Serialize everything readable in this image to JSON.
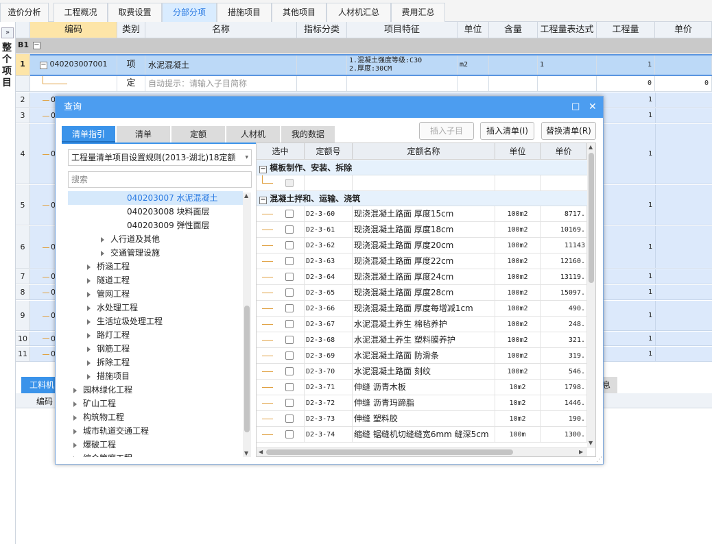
{
  "top_tabs": [
    "造价分析",
    "工程概况",
    "取费设置",
    "分部分项",
    "措施项目",
    "其他项目",
    "人材机汇总",
    "费用汇总"
  ],
  "left_strip": {
    "expand_glyph": "»",
    "label": "整个项目"
  },
  "grid": {
    "headers": [
      "编码",
      "类别",
      "名称",
      "指标分类",
      "项目特征",
      "单位",
      "含量",
      "工程量表达式",
      "工程量",
      "单价"
    ],
    "b1_label": "B1",
    "toggle_minus": "−",
    "row1": {
      "num": "1",
      "code": "040203007001",
      "type": "项",
      "name": "水泥混凝土",
      "feature_line1": "1.混凝土强度等级:C30",
      "feature_line2": "2.厚度:30CM",
      "unit": "m2",
      "expr": "1",
      "qty": "1"
    },
    "row1b": {
      "type": "定",
      "hint": "自动提示：请输入子目简称",
      "qty": "0",
      "price": "0"
    },
    "rows": [
      {
        "num": "2",
        "code_prefix": "0",
        "qty": "1"
      },
      {
        "num": "3",
        "code_prefix": "0",
        "qty": "1"
      },
      {
        "num": "4",
        "code_prefix": "0",
        "qty": "1"
      },
      {
        "num": "5",
        "code_prefix": "0",
        "qty": "1"
      },
      {
        "num": "6",
        "code_prefix": "0",
        "qty": "1"
      },
      {
        "num": "7",
        "code_prefix": "0",
        "qty": "1"
      },
      {
        "num": "8",
        "code_prefix": "0",
        "qty": "1"
      },
      {
        "num": "9",
        "code_prefix": "0",
        "qty": "1"
      },
      {
        "num": "10",
        "code_prefix": "0",
        "qty": "1"
      },
      {
        "num": "11",
        "code_prefix": "0",
        "qty": "1"
      }
    ]
  },
  "bottom": {
    "tab_label": "工料机",
    "header": "编码",
    "right_tab_fragment": "息"
  },
  "dialog": {
    "title": "查询",
    "maximize_glyph": "□",
    "close_glyph": "✕",
    "tabs": [
      "清单指引",
      "清单",
      "定额",
      "人材机",
      "我的数据"
    ],
    "buttons": {
      "insert_sub": "插入子目",
      "insert_list": "插入清单(I)",
      "replace_list": "替换清单(R)"
    },
    "select_value": "工程量清单项目设置规则(2013-湖北)18定额",
    "search_placeholder": "搜索",
    "tree": [
      {
        "text": "040203007  水泥混凝土",
        "level": 3,
        "selected": true
      },
      {
        "text": "040203008  块料面层",
        "level": 3
      },
      {
        "text": "040203009  弹性面层",
        "level": 3
      },
      {
        "text": "人行道及其他",
        "level": 2,
        "arrow": true
      },
      {
        "text": "交通管理设施",
        "level": 2,
        "arrow": true
      },
      {
        "text": "桥涵工程",
        "level": 1,
        "arrow": true
      },
      {
        "text": "隧道工程",
        "level": 1,
        "arrow": true
      },
      {
        "text": "管网工程",
        "level": 1,
        "arrow": true
      },
      {
        "text": "水处理工程",
        "level": 1,
        "arrow": true
      },
      {
        "text": "生活垃圾处理工程",
        "level": 1,
        "arrow": true
      },
      {
        "text": "路灯工程",
        "level": 1,
        "arrow": true
      },
      {
        "text": "钢筋工程",
        "level": 1,
        "arrow": true
      },
      {
        "text": "拆除工程",
        "level": 1,
        "arrow": true
      },
      {
        "text": "措施项目",
        "level": 1,
        "arrow": true
      },
      {
        "text": "园林绿化工程",
        "level": 0,
        "arrow": true
      },
      {
        "text": "矿山工程",
        "level": 0,
        "arrow": true
      },
      {
        "text": "构筑物工程",
        "level": 0,
        "arrow": true
      },
      {
        "text": "城市轨道交通工程",
        "level": 0,
        "arrow": true
      },
      {
        "text": "爆破工程",
        "level": 0,
        "arrow": true
      },
      {
        "text": "综合管廊工程",
        "level": 0,
        "arrow": true
      }
    ],
    "table_headers": [
      "选中",
      "定额号",
      "定额名称",
      "单位",
      "单价"
    ],
    "group1": "模板制作、安装、拆除",
    "group2": "混凝土拌和、运输、浇筑",
    "rows": [
      {
        "code": "D2-3-60",
        "name": "现浇混凝土路面 厚度15cm",
        "unit": "100m2",
        "price": "8717."
      },
      {
        "code": "D2-3-61",
        "name": "现浇混凝土路面 厚度18cm",
        "unit": "100m2",
        "price": "10169."
      },
      {
        "code": "D2-3-62",
        "name": "现浇混凝土路面 厚度20cm",
        "unit": "100m2",
        "price": "11143"
      },
      {
        "code": "D2-3-63",
        "name": "现浇混凝土路面 厚度22cm",
        "unit": "100m2",
        "price": "12160."
      },
      {
        "code": "D2-3-64",
        "name": "现浇混凝土路面 厚度24cm",
        "unit": "100m2",
        "price": "13119."
      },
      {
        "code": "D2-3-65",
        "name": "现浇混凝土路面 厚度28cm",
        "unit": "100m2",
        "price": "15097."
      },
      {
        "code": "D2-3-66",
        "name": "现浇混凝土路面 厚度每增减1cm",
        "unit": "100m2",
        "price": "490."
      },
      {
        "code": "D2-3-67",
        "name": "水泥混凝土养生 棉毡养护",
        "unit": "100m2",
        "price": "248."
      },
      {
        "code": "D2-3-68",
        "name": "水泥混凝土养生 塑料膜养护",
        "unit": "100m2",
        "price": "321."
      },
      {
        "code": "D2-3-69",
        "name": "水泥混凝土路面 防滑条",
        "unit": "100m2",
        "price": "319."
      },
      {
        "code": "D2-3-70",
        "name": "水泥混凝土路面 刻纹",
        "unit": "100m2",
        "price": "546."
      },
      {
        "code": "D2-3-71",
        "name": "伸缝 沥青木板",
        "unit": "10m2",
        "price": "1798."
      },
      {
        "code": "D2-3-72",
        "name": "伸缝 沥青玛蹄脂",
        "unit": "10m2",
        "price": "1446."
      },
      {
        "code": "D2-3-73",
        "name": "伸缝 塑料胶",
        "unit": "10m2",
        "price": "190."
      },
      {
        "code": "D2-3-74",
        "name": "缩缝 锯缝机切缝缝宽6mm 缝深5cm",
        "unit": "100m",
        "price": "1300."
      }
    ]
  }
}
